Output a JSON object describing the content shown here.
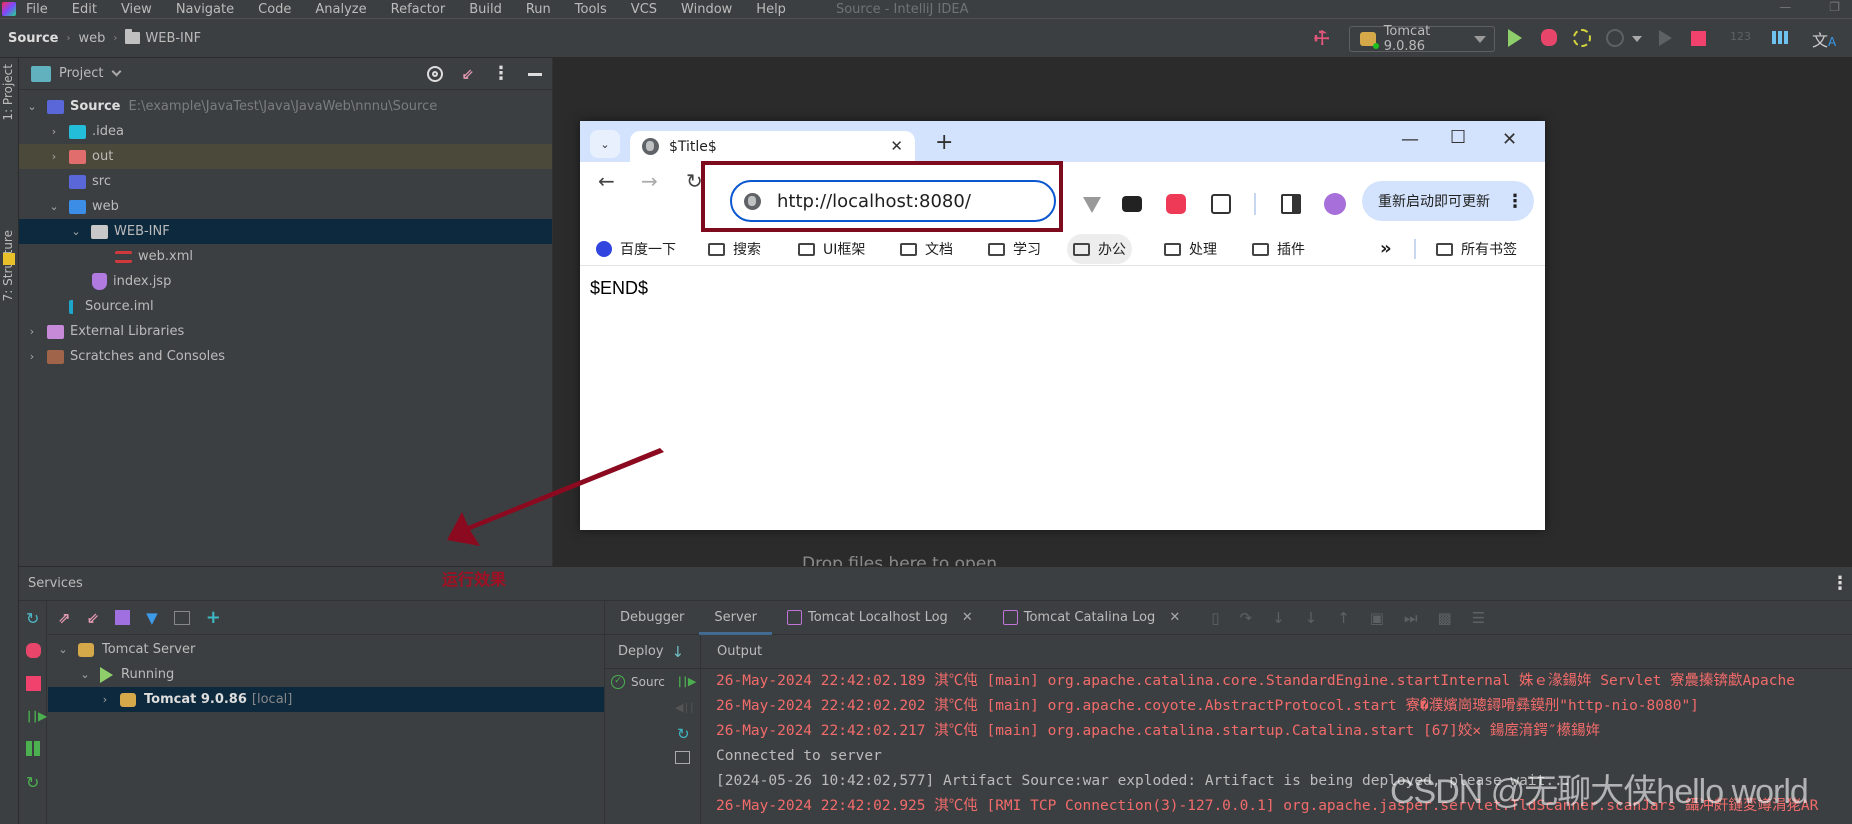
{
  "app": {
    "window_title": "Source - IntelliJ IDEA",
    "menu": [
      "File",
      "Edit",
      "View",
      "Navigate",
      "Code",
      "Analyze",
      "Refactor",
      "Build",
      "Run",
      "Tools",
      "VCS",
      "Window",
      "Help"
    ]
  },
  "breadcrumb": [
    "Source",
    "web",
    "WEB-INF"
  ],
  "toolbar": {
    "run_config": "Tomcat 9.0.86",
    "icons": [
      "build-hammer-icon",
      "run-icon",
      "debug-icon",
      "coverage-icon",
      "profiler-icon",
      "resume-icon",
      "stop-icon",
      "numbers-icon",
      "layout-grid-icon",
      "translate-icon"
    ]
  },
  "left_strip": {
    "tabs": [
      "1: Project",
      "7: Structure"
    ]
  },
  "project": {
    "header": "Project",
    "root": {
      "name": "Source",
      "path": "E:\\example\\JavaTest\\Java\\JavaWeb\\nnnu\\Source"
    },
    "items": [
      {
        "name": ".idea"
      },
      {
        "name": "out"
      },
      {
        "name": "src"
      },
      {
        "name": "web"
      },
      {
        "name": "WEB-INF"
      },
      {
        "name": "web.xml"
      },
      {
        "name": "index.jsp"
      },
      {
        "name": "Source.iml"
      },
      {
        "name": "External Libraries"
      },
      {
        "name": "Scratches and Consoles"
      }
    ]
  },
  "editor": {
    "drop_hint": "Drop files here to open"
  },
  "browser": {
    "tab_title": "$Title$",
    "url": "http://localhost:8080/",
    "update_button": "重新启动即可更新",
    "bookmarks": [
      "百度一下",
      "搜索",
      "UI框架",
      "文档",
      "学习",
      "办公",
      "处理",
      "插件",
      "所有书签"
    ],
    "more_bookmarks": "»",
    "page_text": "$END$"
  },
  "annotation": {
    "label": "运行效果",
    "color": "#8b0a1f"
  },
  "services": {
    "title": "Services",
    "tree": [
      {
        "label": "Tomcat Server"
      },
      {
        "label": "Running"
      },
      {
        "label": "Tomcat 9.0.86",
        "suffix": "[local]"
      }
    ],
    "tabs": [
      {
        "label": "Debugger"
      },
      {
        "label": "Server"
      },
      {
        "label": "Tomcat Localhost Log"
      },
      {
        "label": "Tomcat Catalina Log"
      }
    ],
    "deploy_label": "Deploy",
    "output_label": "Output",
    "deploy_item": "Sourc",
    "log": [
      {
        "text": "26-May-2024 22:42:02.189 淇℃伅 [main] org.apache.catalina.core.StandardEngine.startInternal 姝ｅ湪鍚姩 Servlet 寮曟搸锛歔Apache",
        "level": "error"
      },
      {
        "text": "26-May-2024 22:42:02.202 淇℃伅 [main] org.apache.coyote.AbstractProtocol.start 寮�濮嬪崗璁鐞嗗彞鏌刐\"http-nio-8080\"]",
        "level": "error"
      },
      {
        "text": "26-May-2024 22:42:02.217 淇℃伅 [main] org.apache.catalina.startup.Catalina.start [67]姣✕ 鍚庢湇鍔″櫒鍚姩",
        "level": "error"
      },
      {
        "text": "Connected to server",
        "level": "info"
      },
      {
        "text": "[2024-05-26 10:42:02,577] Artifact Source:war exploded: Artifact is being deployed, please wait...",
        "level": "info"
      },
      {
        "text": "26-May-2024 22:42:02.925 淇℃伅 [RMI TCP Connection(3)-127.0.0.1] org.apache.jasper.servlet.TldScanner.scanJars 鑷冲皯鏈変竴涓狫AR",
        "level": "error"
      }
    ]
  },
  "watermark": "CSDN @无聊大侠hello world",
  "colors": {
    "ide_bg": "#3c3f41",
    "selection": "#0d293e",
    "log_error": "#f26b6b",
    "browser_accent": "#0b57d0",
    "annotation_red": "#7d0a1d"
  }
}
